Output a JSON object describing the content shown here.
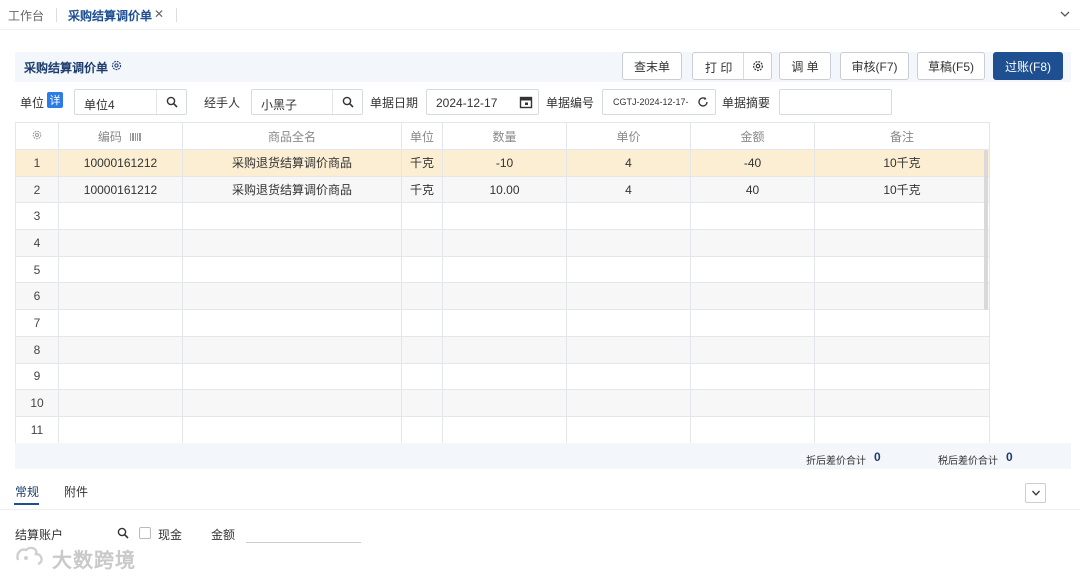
{
  "tabs": {
    "home": "工作台",
    "active": "采购结算调价单"
  },
  "page": {
    "title": "采购结算调价单"
  },
  "toolbar": {
    "last_doc": "查末单",
    "print": "打 印",
    "adjust": "调 单",
    "audit": "审核(F7)",
    "draft": "草稿(F5)",
    "post": "过账(F8)"
  },
  "form": {
    "unit_label": "单位",
    "detail_badge": "详",
    "unit_value": "单位4",
    "handler_label": "经手人",
    "handler_value": "小黑子",
    "date_label": "单据日期",
    "date_value": "2024-12-17",
    "docno_label": "单据编号",
    "docno_value": "CGTJ-2024-12-17-",
    "summary_label": "单据摘要",
    "summary_value": ""
  },
  "table": {
    "headers": [
      "编码",
      "商品全名",
      "单位",
      "数量",
      "单价",
      "金额",
      "备注"
    ],
    "rows": [
      {
        "no": "1",
        "code": "10000161212",
        "name": "采购退货结算调价商品",
        "unit": "千克",
        "qty": "-10",
        "price": "4",
        "amount": "-40",
        "remark": "10千克"
      },
      {
        "no": "2",
        "code": "10000161212",
        "name": "采购退货结算调价商品",
        "unit": "千克",
        "qty": "10.00",
        "price": "4",
        "amount": "40",
        "remark": "10千克"
      },
      {
        "no": "3",
        "code": "",
        "name": "",
        "unit": "",
        "qty": "",
        "price": "",
        "amount": "",
        "remark": ""
      },
      {
        "no": "4",
        "code": "",
        "name": "",
        "unit": "",
        "qty": "",
        "price": "",
        "amount": "",
        "remark": ""
      },
      {
        "no": "5",
        "code": "",
        "name": "",
        "unit": "",
        "qty": "",
        "price": "",
        "amount": "",
        "remark": ""
      },
      {
        "no": "6",
        "code": "",
        "name": "",
        "unit": "",
        "qty": "",
        "price": "",
        "amount": "",
        "remark": ""
      },
      {
        "no": "7",
        "code": "",
        "name": "",
        "unit": "",
        "qty": "",
        "price": "",
        "amount": "",
        "remark": ""
      },
      {
        "no": "8",
        "code": "",
        "name": "",
        "unit": "",
        "qty": "",
        "price": "",
        "amount": "",
        "remark": ""
      },
      {
        "no": "9",
        "code": "",
        "name": "",
        "unit": "",
        "qty": "",
        "price": "",
        "amount": "",
        "remark": ""
      },
      {
        "no": "10",
        "code": "",
        "name": "",
        "unit": "",
        "qty": "",
        "price": "",
        "amount": "",
        "remark": ""
      },
      {
        "no": "11",
        "code": "",
        "name": "",
        "unit": "",
        "qty": "",
        "price": "",
        "amount": "",
        "remark": ""
      }
    ]
  },
  "summary": {
    "after_discount_label": "折后差价合计",
    "after_discount_value": "0",
    "after_tax_label": "税后差价合计",
    "after_tax_value": "0"
  },
  "bottom_tabs": {
    "general": "常规",
    "attachment": "附件"
  },
  "bottom_form": {
    "account_label": "结算账户",
    "cash_label": "现金",
    "amount_label": "金额"
  },
  "watermark": "大数跨境",
  "colors": {
    "primary": "#1d4f91",
    "selected_row": "#fbeed3",
    "panel_bg": "#f3f6fb"
  }
}
